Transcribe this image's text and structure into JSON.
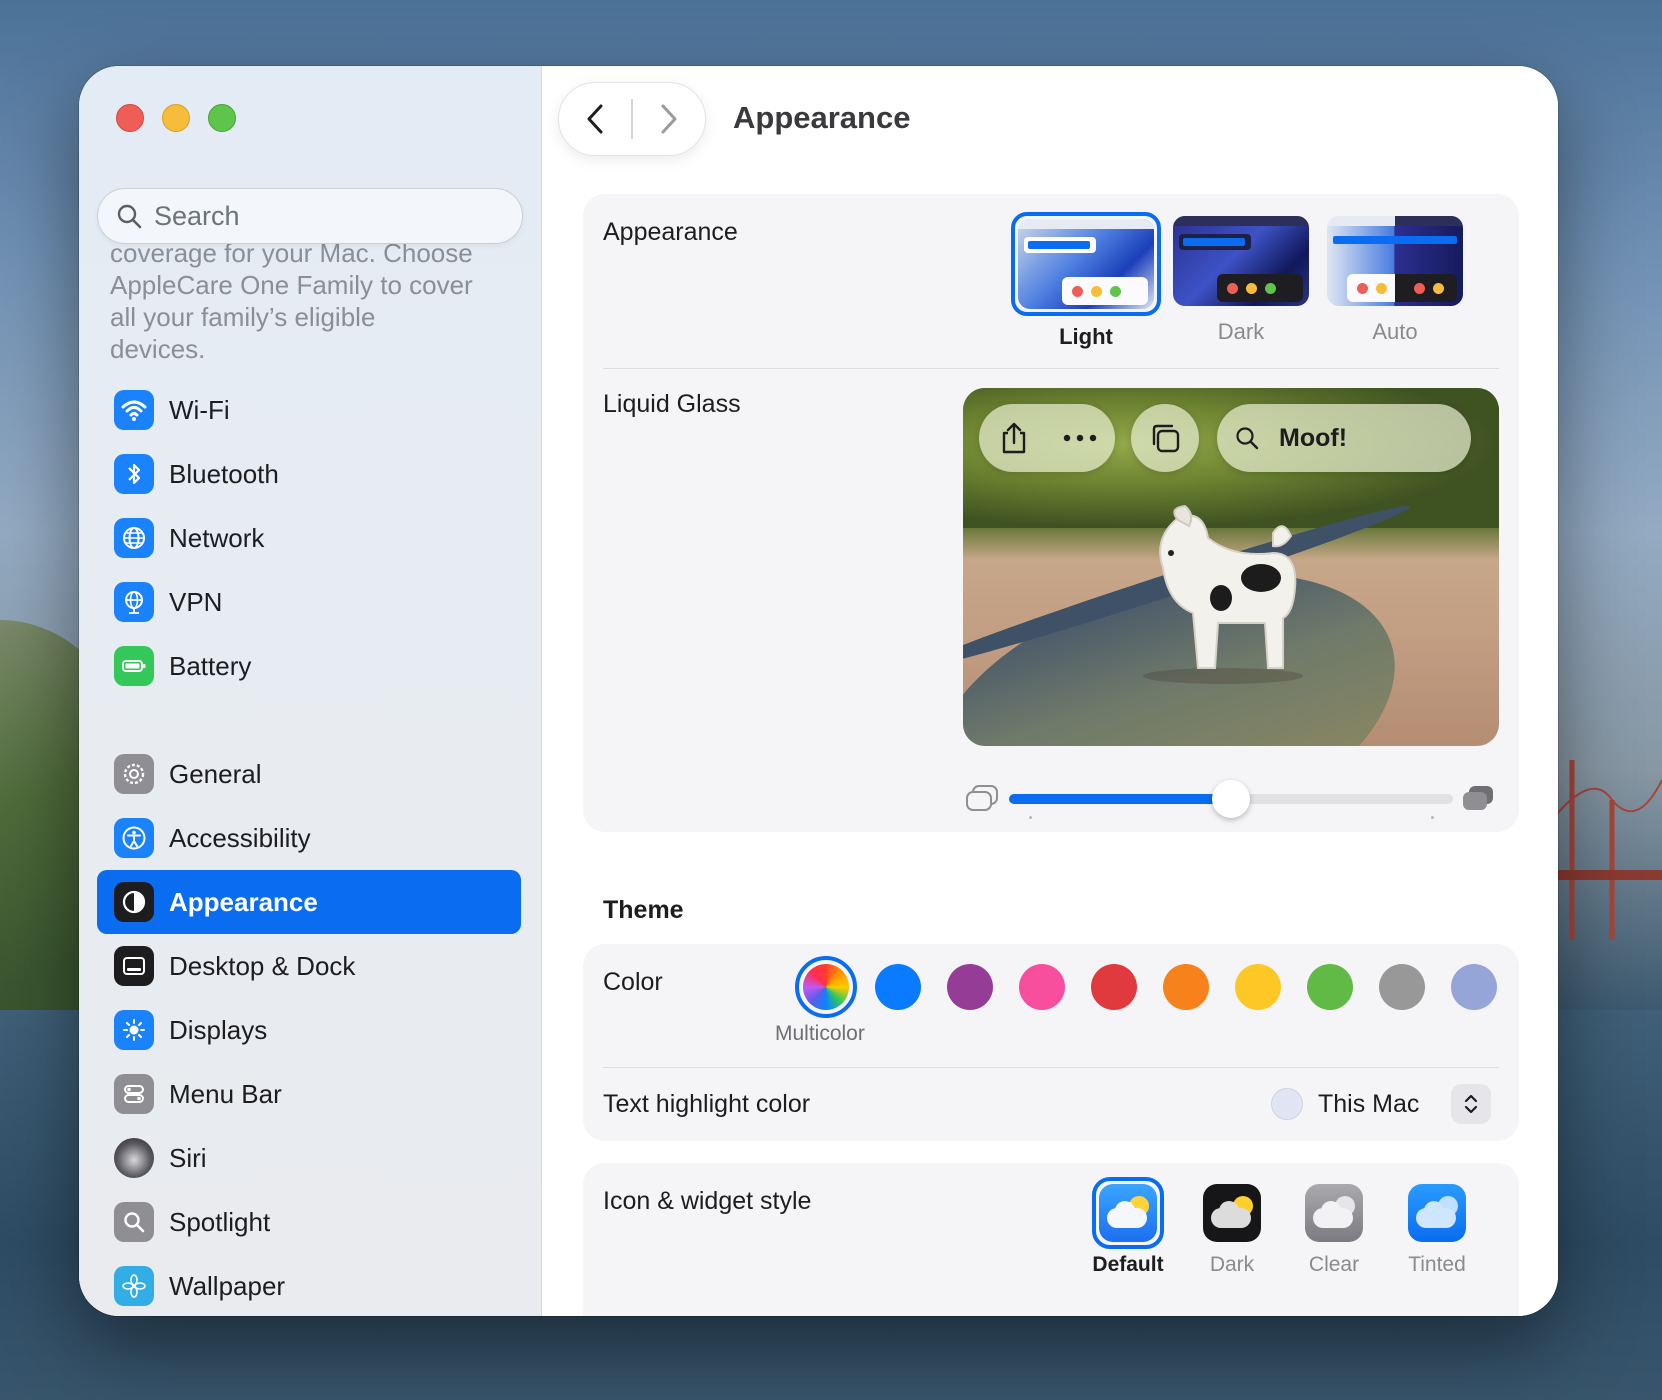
{
  "window": {
    "title": "Appearance"
  },
  "search": {
    "placeholder": "Search"
  },
  "sidebar": {
    "promo_lines": [
      "coverage for your Mac. Choose",
      "AppleCare One Family to cover",
      "all your family’s eligible",
      "devices."
    ],
    "items": [
      {
        "label": "Wi-Fi",
        "icon": "wifi-icon",
        "color": "#1a82fb"
      },
      {
        "label": "Bluetooth",
        "icon": "bluetooth-icon",
        "color": "#1a82fb"
      },
      {
        "label": "Network",
        "icon": "globe-icon",
        "color": "#1a82fb"
      },
      {
        "label": "VPN",
        "icon": "vpn-icon",
        "color": "#1a82fb"
      },
      {
        "label": "Battery",
        "icon": "battery-icon",
        "color": "#34c759"
      },
      {
        "label": "General",
        "icon": "gear-icon",
        "color": "#8e8e93"
      },
      {
        "label": "Accessibility",
        "icon": "accessibility-icon",
        "color": "#1a82fb"
      },
      {
        "label": "Appearance",
        "icon": "appearance-icon",
        "color": "#1d1d1f",
        "selected": true
      },
      {
        "label": "Desktop & Dock",
        "icon": "dock-icon",
        "color": "#1d1d1f"
      },
      {
        "label": "Displays",
        "icon": "sun-icon",
        "color": "#1a82fb"
      },
      {
        "label": "Menu Bar",
        "icon": "menubar-icon",
        "color": "#8e8e93"
      },
      {
        "label": "Siri",
        "icon": "siri-icon",
        "color": "#2c2c2e"
      },
      {
        "label": "Spotlight",
        "icon": "magnifier-icon",
        "color": "#8e8e93"
      },
      {
        "label": "Wallpaper",
        "icon": "flower-icon",
        "color": "#32ade6"
      }
    ]
  },
  "appearance": {
    "label": "Appearance",
    "options": [
      {
        "label": "Light",
        "selected": true
      },
      {
        "label": "Dark",
        "selected": false
      },
      {
        "label": "Auto",
        "selected": false
      }
    ]
  },
  "liquid_glass": {
    "label": "Liquid Glass",
    "search_text": "Moof!",
    "slider_value": 0.5
  },
  "theme": {
    "title": "Theme",
    "color_label": "Color",
    "selected_color": "Multicolor",
    "colors": [
      "multicolor",
      "#0a7aff",
      "#953d96",
      "#f74f9e",
      "#e0393e",
      "#f7821b",
      "#fdc726",
      "#62ba46",
      "#989898",
      "#95a5d8"
    ],
    "highlight_label": "Text highlight color",
    "highlight_value": "This Mac",
    "highlight_swatch": "#e1e4f2"
  },
  "icon_style": {
    "label": "Icon & widget style",
    "options": [
      {
        "label": "Default",
        "selected": true
      },
      {
        "label": "Dark",
        "selected": false
      },
      {
        "label": "Clear",
        "selected": false
      },
      {
        "label": "Tinted",
        "selected": false
      }
    ]
  }
}
